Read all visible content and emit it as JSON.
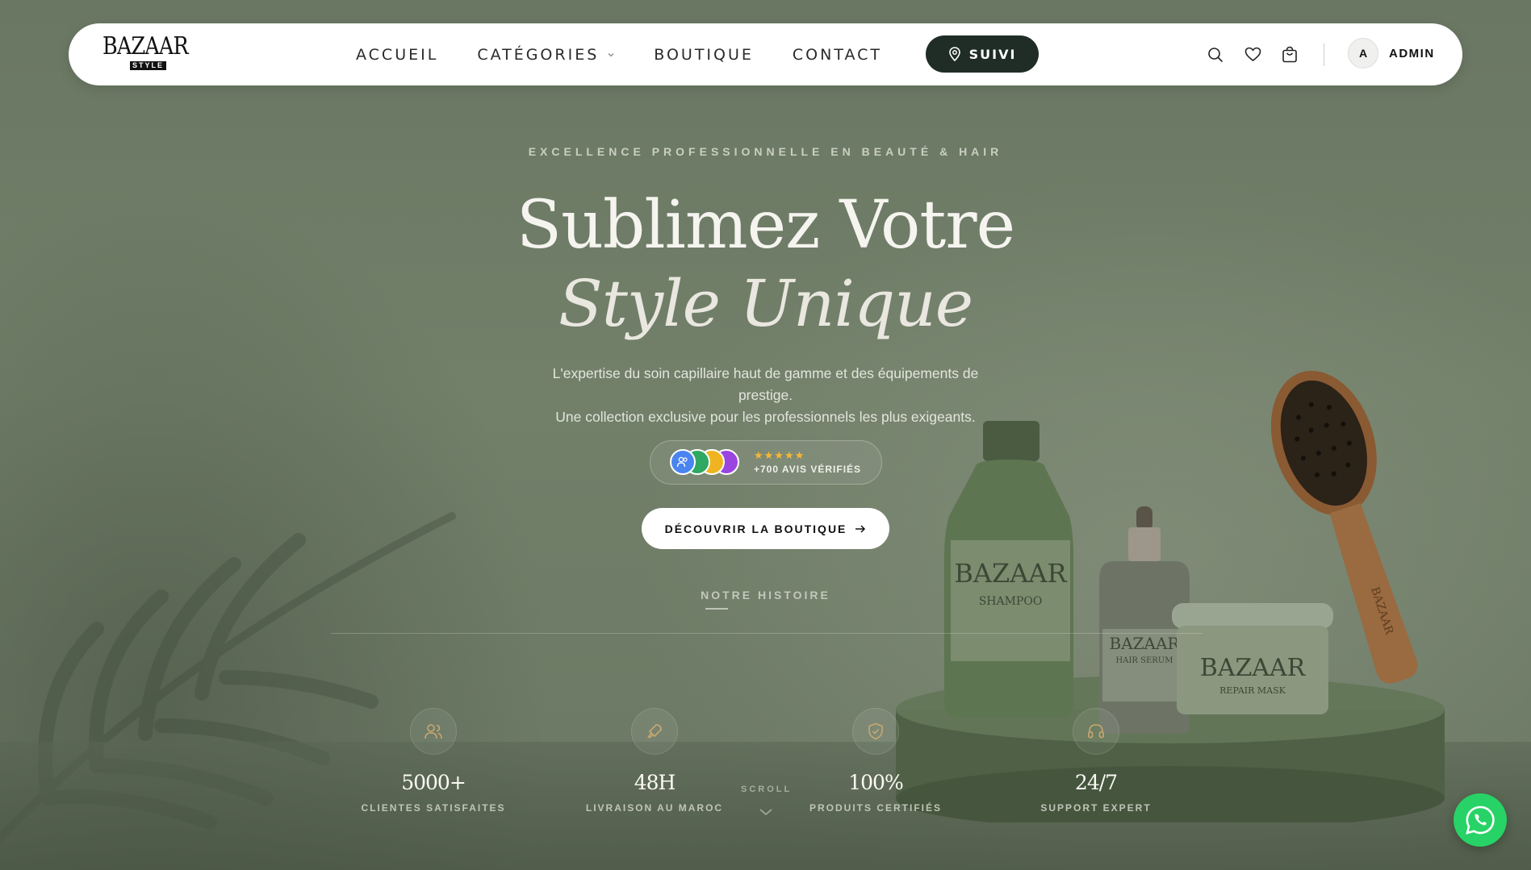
{
  "brand": {
    "logo_main": "BAZAAR",
    "logo_sub": "STYLE"
  },
  "nav": {
    "links": [
      {
        "label": "ACCUEIL"
      },
      {
        "label": "CATÉGORIES"
      },
      {
        "label": "BOUTIQUE"
      },
      {
        "label": "CONTACT"
      }
    ],
    "tracking_button": "SUIVI",
    "icons": [
      "search-icon",
      "heart-icon",
      "cart-icon"
    ],
    "user": {
      "initial": "A",
      "name": "ADMIN"
    }
  },
  "hero": {
    "eyebrow": "EXCELLENCE PROFESSIONNELLE EN BEAUTÉ & HAIR",
    "title_line1": "Sublimez Votre",
    "title_line2": "Style Unique",
    "subtitle_line1": "L'expertise du soin capillaire haut de gamme et des équipements de prestige.",
    "subtitle_line2": "Une collection exclusive pour les professionnels les plus exigeants.",
    "reviews": {
      "stars": "★★★★★",
      "text": "+700 AVIS VÉRIFIÉS"
    },
    "cta": "DÉCOUVRIR LA BOUTIQUE",
    "story_link": "NOTRE HISTOIRE"
  },
  "products": {
    "shampoo": {
      "brand": "BAZAAR",
      "name": "SHAMPOO"
    },
    "serum": {
      "brand": "BAZAAR",
      "name": "HAIR SERUM"
    },
    "mask": {
      "brand": "BAZAAR",
      "name": "REPAIR MASK"
    },
    "brush": {
      "brand": "BAZAAR"
    }
  },
  "stats": [
    {
      "icon": "users-icon",
      "value": "5000+",
      "label": "CLIENTES SATISFAITES"
    },
    {
      "icon": "rocket-icon",
      "value": "48H",
      "label": "LIVRAISON AU MAROC"
    },
    {
      "icon": "shield-check-icon",
      "value": "100%",
      "label": "PRODUITS CERTIFIÉS"
    },
    {
      "icon": "headphones-icon",
      "value": "24/7",
      "label": "SUPPORT EXPERT"
    }
  ],
  "scroll_label": "SCROLL",
  "colors": {
    "dark_green": "#1f2d26",
    "whatsapp": "#27d366",
    "star": "#f6b833"
  }
}
